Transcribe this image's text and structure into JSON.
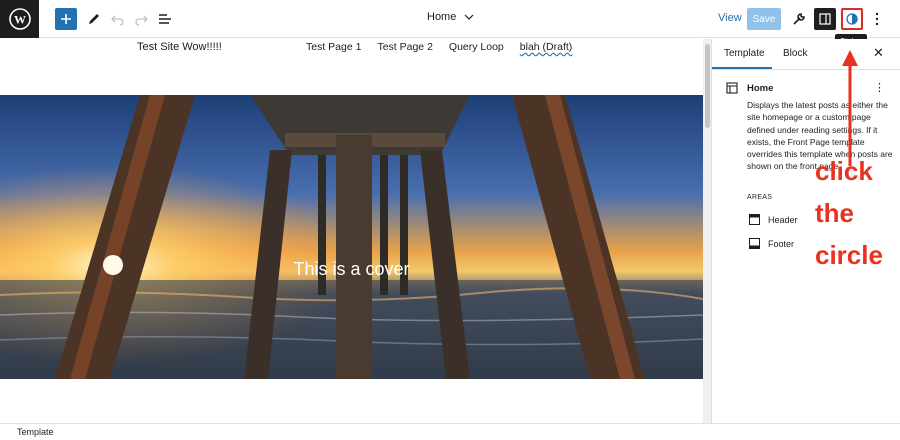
{
  "toolbar": {
    "document_title": "Home",
    "view_label": "View",
    "save_label": "Save",
    "tooltip": "Styles"
  },
  "site": {
    "title": "Test Site Wow!!!!!",
    "nav": [
      "Test Page 1",
      "Test Page 2",
      "Query Loop",
      "blah (Draft)"
    ]
  },
  "cover": {
    "text": "This is a cover"
  },
  "sidebar": {
    "tabs": [
      "Template",
      "Block"
    ],
    "template_name": "Home",
    "template_description": "Displays the latest posts as either the site homepage or a custom page defined under reading settings. If it exists, the Front Page template overrides this template when posts are shown on the front page.",
    "areas_label": "AREAS",
    "areas": [
      "Header",
      "Footer"
    ]
  },
  "annotation": {
    "lines": [
      "click",
      "the",
      "circle"
    ],
    "color": "#e8311e"
  },
  "statusbar": {
    "breadcrumb": "Template"
  },
  "colors": {
    "accent": "#2271b1",
    "save_disabled": "#8fc1ea",
    "dark": "#1e1e1e"
  }
}
